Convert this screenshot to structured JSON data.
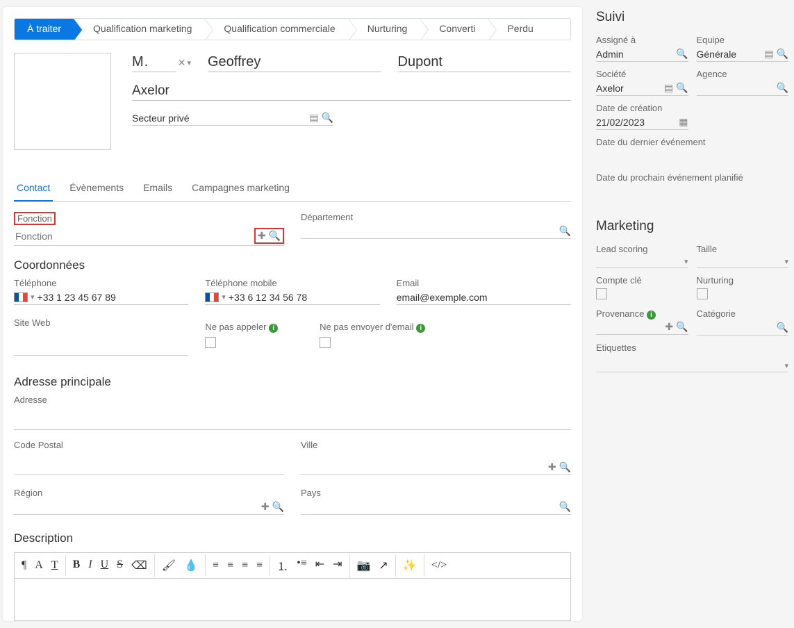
{
  "stepper": [
    "À traiter",
    "Qualification marketing",
    "Qualification commerciale",
    "Nurturing",
    "Converti",
    "Perdu"
  ],
  "active_step": 0,
  "header": {
    "salutation": "M.",
    "first_name": "Geoffrey",
    "last_name": "Dupont",
    "company": "Axelor",
    "sector": "Secteur privé"
  },
  "tabs": [
    "Contact",
    "Évènements",
    "Emails",
    "Campagnes marketing"
  ],
  "active_tab": 0,
  "contact": {
    "fonction_label": "Fonction",
    "fonction_placeholder": "Fonction",
    "departement_label": "Département",
    "coord_title": "Coordonnées",
    "tel_label": "Téléphone",
    "tel_val": "+33 1 23 45 67 89",
    "mob_label": "Téléphone mobile",
    "mob_val": "+33 6 12 34 56 78",
    "email_label": "Email",
    "email_val": "email@exemple.com",
    "site_label": "Site Web",
    "nocall_label": "Ne pas appeler",
    "nomail_label": "Ne pas envoyer d'email",
    "addr_title": "Adresse principale",
    "addr_label": "Adresse",
    "cp_label": "Code Postal",
    "ville_label": "Ville",
    "region_label": "Région",
    "pays_label": "Pays",
    "desc_title": "Description"
  },
  "suivi": {
    "title": "Suivi",
    "assignee_label": "Assigné à",
    "assignee_val": "Admin",
    "team_label": "Equipe",
    "team_val": "Générale",
    "company_label": "Société",
    "company_val": "Axelor",
    "agency_label": "Agence",
    "created_label": "Date de création",
    "created_val": "21/02/2023",
    "last_event_label": "Date du dernier événement",
    "next_event_label": "Date du prochain événement planifié"
  },
  "marketing": {
    "title": "Marketing",
    "score_label": "Lead scoring",
    "size_label": "Taille",
    "key_label": "Compte clé",
    "nurturing_label": "Nurturing",
    "prov_label": "Provenance",
    "cat_label": "Catégorie",
    "tags_label": "Etiquettes"
  }
}
